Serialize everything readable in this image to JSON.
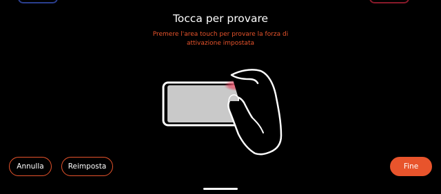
{
  "header": {
    "title": "Tocca per provare",
    "subtitle": "Premere l'area touch per provare la forza di attivazione impostata"
  },
  "illustration": {
    "icon": "phone-touch-hand-icon",
    "accent_color": "#e8542c",
    "touch_color": "#e0405a"
  },
  "buttons": {
    "cancel_label": "Annulla",
    "reset_label": "Reimposta",
    "done_label": "Fine"
  },
  "colors": {
    "background": "#000000",
    "accent": "#e8542c",
    "text": "#ffffff"
  }
}
